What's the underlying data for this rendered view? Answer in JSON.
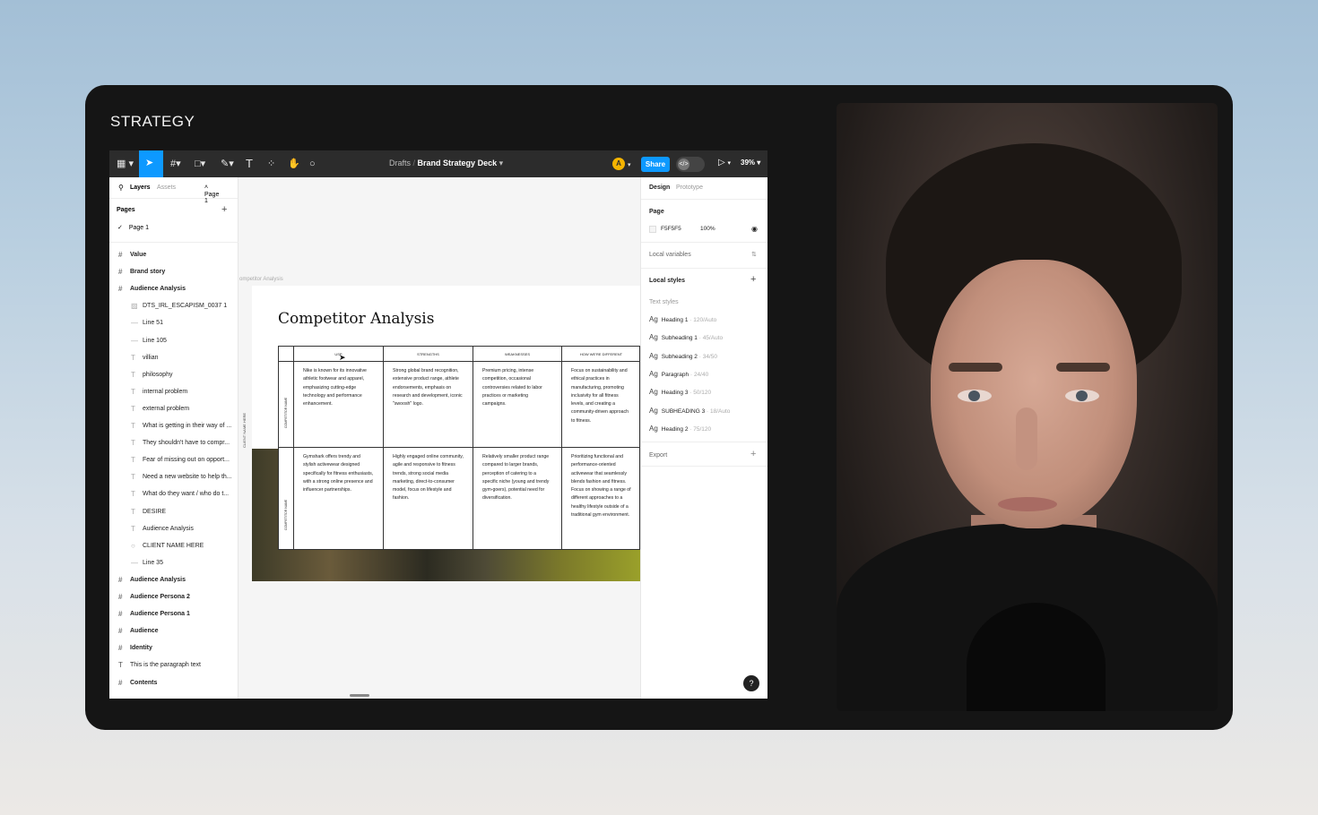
{
  "section_title": "STRATEGY",
  "toolbar": {
    "breadcrumb_parent": "Drafts",
    "file_name": "Brand Strategy Deck",
    "avatar_initial": "A",
    "share_label": "Share",
    "zoom": "39%"
  },
  "left_panel": {
    "tab_layers": "Layers",
    "tab_assets": "Assets",
    "page_selector": "Page 1",
    "pages_heading": "Pages",
    "current_page": "Page 1",
    "layers": [
      {
        "label": "Value",
        "kind": "frame"
      },
      {
        "label": "Brand story",
        "kind": "frame"
      },
      {
        "label": "Audience Analysis",
        "kind": "frame"
      },
      {
        "label": "DTS_IRL_ESCAPISM_0037 1",
        "kind": "image"
      },
      {
        "label": "Line 51",
        "kind": "line"
      },
      {
        "label": "Line 105",
        "kind": "line"
      },
      {
        "label": "villian",
        "kind": "text"
      },
      {
        "label": "philosophy",
        "kind": "text"
      },
      {
        "label": "internal problem",
        "kind": "text"
      },
      {
        "label": "external problem",
        "kind": "text"
      },
      {
        "label": "What is getting in their way of ...",
        "kind": "text"
      },
      {
        "label": "They shouldn't have to compr...",
        "kind": "text"
      },
      {
        "label": "Fear of missing out on opport...",
        "kind": "text"
      },
      {
        "label": "Need a new website to help th...",
        "kind": "text"
      },
      {
        "label": "What do they want / who do t...",
        "kind": "text"
      },
      {
        "label": "DESIRE",
        "kind": "text"
      },
      {
        "label": "Audience Analysis",
        "kind": "text"
      },
      {
        "label": "CLIENT NAME HERE",
        "kind": "ellipse"
      },
      {
        "label": "Line 35",
        "kind": "line"
      },
      {
        "label": "Audience Analysis",
        "kind": "frame"
      },
      {
        "label": "Audience Persona 2",
        "kind": "frame"
      },
      {
        "label": "Audience Persona 1",
        "kind": "frame"
      },
      {
        "label": "Audience",
        "kind": "frame"
      },
      {
        "label": "Identity",
        "kind": "frame"
      },
      {
        "label": "This is the paragraph text",
        "kind": "text-top"
      },
      {
        "label": "Contents",
        "kind": "frame"
      }
    ]
  },
  "canvas": {
    "frame_label": "ompetitor Analysis",
    "board_title": "Competitor Analysis",
    "side_label": "CLIENT NAME HERE",
    "columns": [
      "USP",
      "STRENGTHS",
      "WEAKNESSES",
      "HOW WE'RE DIFFERENT"
    ],
    "row_labels": [
      "COMPETITOR NAME",
      "COMPETITOR NAME"
    ],
    "rows": [
      [
        "Nike is known for its innovative athletic footwear and apparel, emphasizing cutting-edge technology and performance enhancement.",
        "Strong global brand recognition, extensive product range, athlete endorsements, emphasis on research and development, iconic \"swoosh\" logo.",
        "Premium pricing, intense competition, occasional controversies related to labor practices or marketing campaigns.",
        "Focus on sustainability and ethical practices in manufacturing, promoting inclusivity for all fitness levels, and creating a community-driven approach to fitness."
      ],
      [
        "Gymshark offers trendy and stylish activewear designed specifically for fitness enthusiasts, with a strong online presence and influencer partnerships.",
        "Highly engaged online community, agile and responsive to fitness trends, strong social media marketing, direct-to-consumer model, focus on lifestyle and fashion.",
        "Relatively smaller product range compared to larger brands, perception of catering to a specific niche (young and trendy gym-goers), potential need for diversification.",
        "Prioritizing functional and performance-oriented activewear that seamlessly blends fashion and fitness. Focus on showing a range of different approaches to a healthy lifestyle outside of a traditional gym environment."
      ]
    ]
  },
  "right_panel": {
    "tab_design": "Design",
    "tab_prototype": "Prototype",
    "page_heading": "Page",
    "page_color": "F5F5F5",
    "page_opacity": "100%",
    "local_variables": "Local variables",
    "local_styles": "Local styles",
    "text_styles": "Text styles",
    "styles": [
      {
        "name": "Heading 1",
        "spec": "120/Auto"
      },
      {
        "name": "Subheading 1",
        "spec": "45/Auto"
      },
      {
        "name": "Subheading 2",
        "spec": "34/50"
      },
      {
        "name": "Paragraph",
        "spec": "24/40"
      },
      {
        "name": "Heading 3",
        "spec": "50/120"
      },
      {
        "name": "SUBHEADING 3",
        "spec": "18/Auto"
      },
      {
        "name": "Heading 2",
        "spec": "75/120"
      }
    ],
    "export": "Export",
    "help": "?"
  },
  "colors": {
    "accent": "#0d99ff",
    "toolbar_bg": "#2c2c2c",
    "frame_bg": "#151515"
  }
}
